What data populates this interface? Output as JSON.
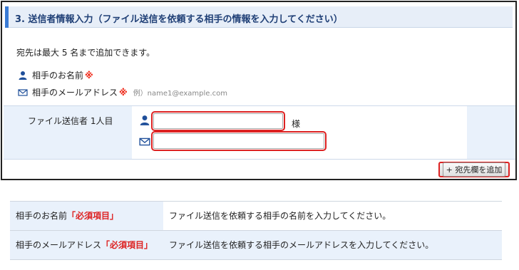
{
  "panel": {
    "title": "3. 送信者情報入力（ファイル送信を依頼する相手の情報を入力してください）",
    "intro": "宛先は最大 5 名まで追加できます。",
    "legend": {
      "name_label": "相手のお名前",
      "email_label": "相手のメールアドレス",
      "required_mark": "※",
      "example": "例）name1@example.com"
    },
    "form": {
      "row_label": "ファイル送信者 1人目",
      "name_value": "",
      "email_value": "",
      "honorific": "様"
    },
    "add_button_label": "+ 宛先欄を追加"
  },
  "help_table": {
    "rows": [
      {
        "field": "相手のお名前",
        "required": "「必須項目」",
        "description": "ファイル送信を依頼する相手の名前を入力してください。"
      },
      {
        "field": "相手のメールアドレス",
        "required": "「必須項目」",
        "description": "ファイル送信を依頼する相手のメールアドレスを入力してください。"
      }
    ]
  },
  "colors": {
    "accent": "#3a7bd5",
    "highlight": "#d22222",
    "header_bg": "#e7eef8",
    "row_bg": "#e9f1fb"
  },
  "icons": {
    "person": "person-icon",
    "mail": "mail-icon"
  }
}
